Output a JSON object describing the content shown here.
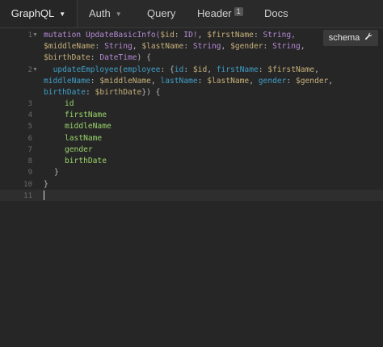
{
  "tabs": {
    "graphql": "GraphQL",
    "auth": "Auth",
    "query": "Query",
    "header": "Header",
    "header_badge": "1",
    "docs": "Docs"
  },
  "schema_button": {
    "label": "schema",
    "icon": "wrench-icon"
  },
  "line_numbers": [
    "1",
    "2",
    "3",
    "4",
    "5",
    "6",
    "7",
    "8",
    "9",
    "10",
    "11"
  ],
  "code": {
    "l1a": "mutation ",
    "l1b": "UpdateBasicInfo(",
    "l1c": "$id",
    "l1d": ": ",
    "l1e": "ID!",
    "l1f": ", ",
    "l1g": "$firstName",
    "l1h": ": ",
    "l1i": "String,",
    "l2a": "$middleName",
    "l2b": ": ",
    "l2c": "String",
    "l2d": ", ",
    "l2e": "$lastName",
    "l2f": ": ",
    "l2g": "String",
    "l2h": ", ",
    "l2i": "$gender",
    "l2j": ": ",
    "l2k": "String",
    "l2l": ",",
    "l3a": "$birthDate",
    "l3b": ": ",
    "l3c": "DateTime",
    "l3d": ") {",
    "l4a": "  ",
    "l4b": "updateEmployee",
    "l4c": "(",
    "l4d": "employee",
    "l4e": ": {",
    "l4f": "id",
    "l4g": ": ",
    "l4h": "$id",
    "l4i": ", ",
    "l4j": "firstName",
    "l4k": ": ",
    "l4l": "$firstName",
    "l4m": ",",
    "l5a": "middleName",
    "l5b": ": ",
    "l5c": "$middleName",
    "l5d": ", ",
    "l5e": "lastName",
    "l5f": ": ",
    "l5g": "$lastName",
    "l5h": ", ",
    "l5i": "gender",
    "l5j": ": ",
    "l5k": "$gender",
    "l5l": ",",
    "l6a": "birthDate",
    "l6b": ": ",
    "l6c": "$birthDate",
    "l6d": "}) {",
    "f1": "id",
    "f2": "firstName",
    "f3": "middleName",
    "f4": "lastName",
    "f5": "gender",
    "f6": "birthDate",
    "close1": "}",
    "close2": "}"
  },
  "colors": {
    "background": "#262626",
    "keyword": "#b58ad6",
    "variable": "#c7b07a",
    "call": "#3f9ec7",
    "field": "#9bd36b"
  }
}
